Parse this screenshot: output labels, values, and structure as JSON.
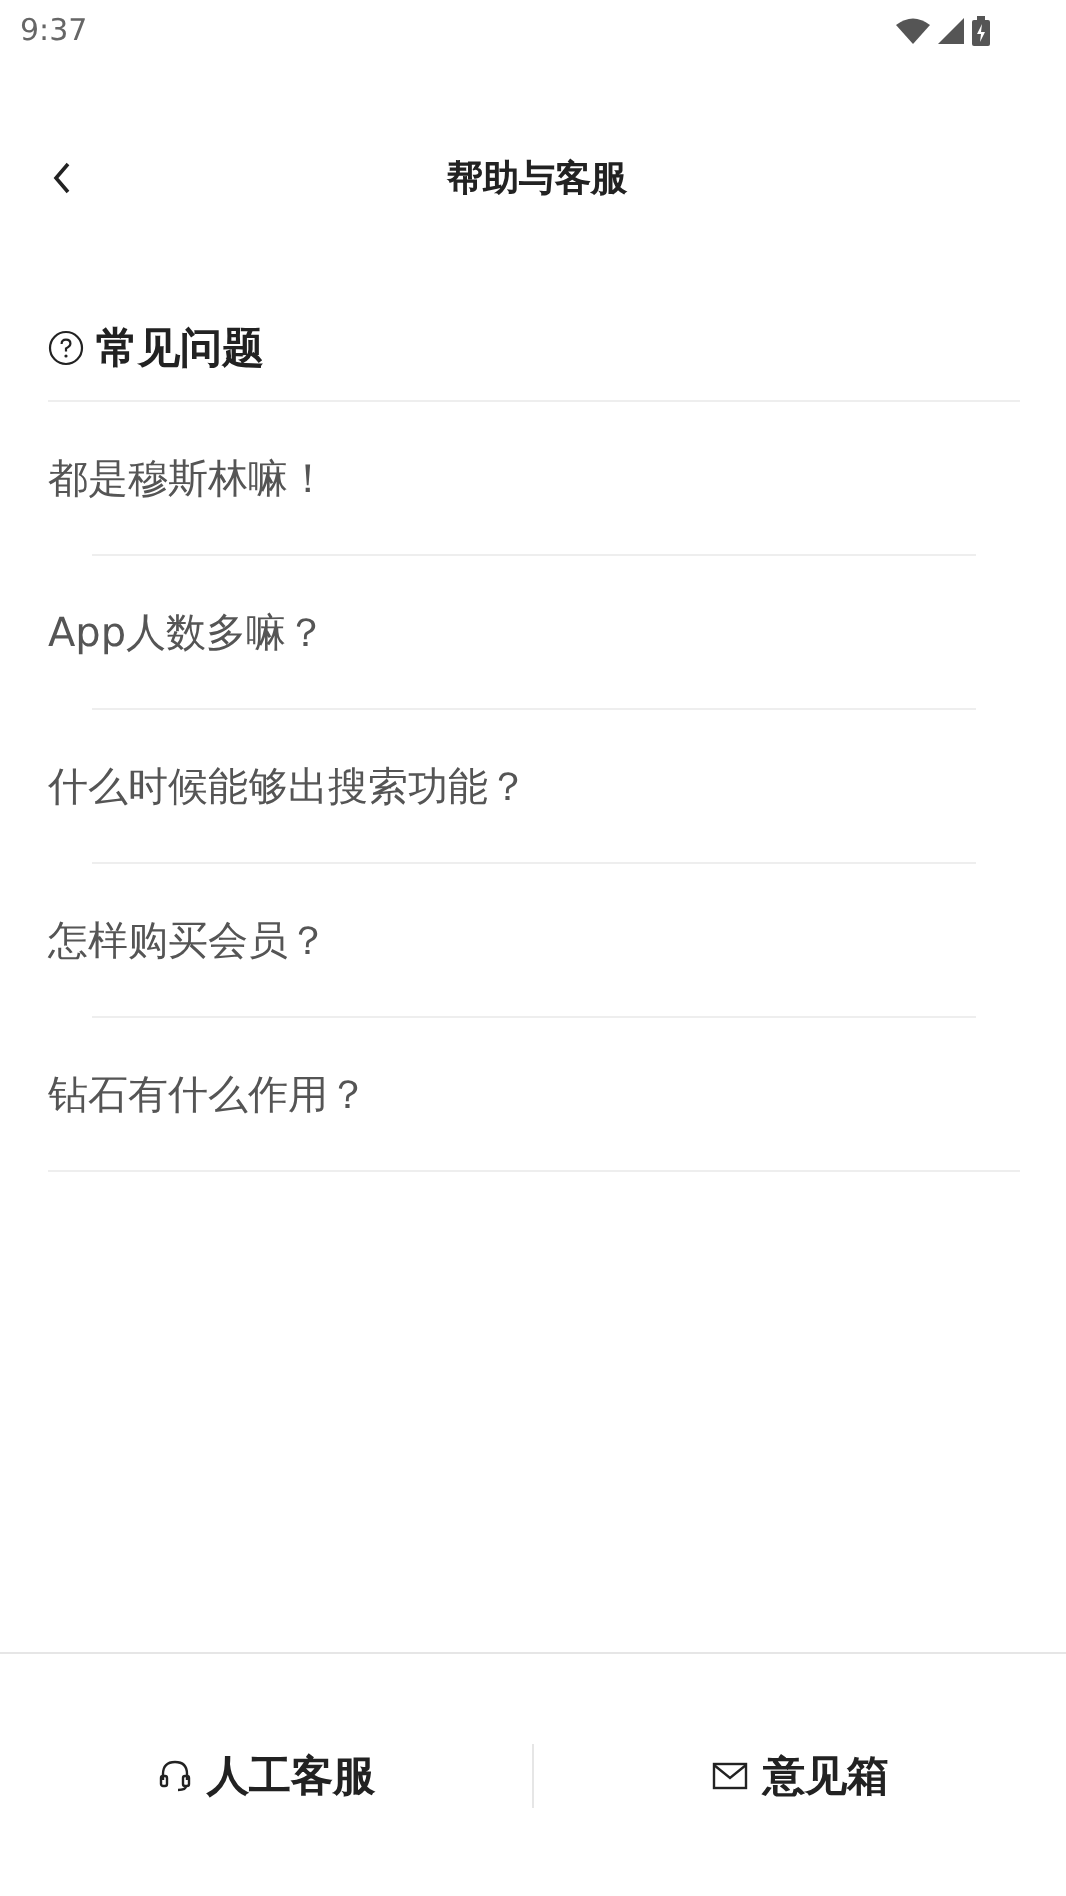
{
  "status_bar": {
    "time": "9:37"
  },
  "header": {
    "title": "帮助与客服"
  },
  "section": {
    "title": "常见问题"
  },
  "faq": [
    {
      "question": "都是穆斯林嘛！"
    },
    {
      "question": "App人数多嘛？"
    },
    {
      "question": "什么时候能够出搜索功能？"
    },
    {
      "question": "怎样购买会员？"
    },
    {
      "question": "钻石有什么作用？"
    }
  ],
  "bottom_bar": [
    {
      "kind": "support",
      "label": "人工客服"
    },
    {
      "kind": "mail",
      "label": "意见箱"
    }
  ]
}
